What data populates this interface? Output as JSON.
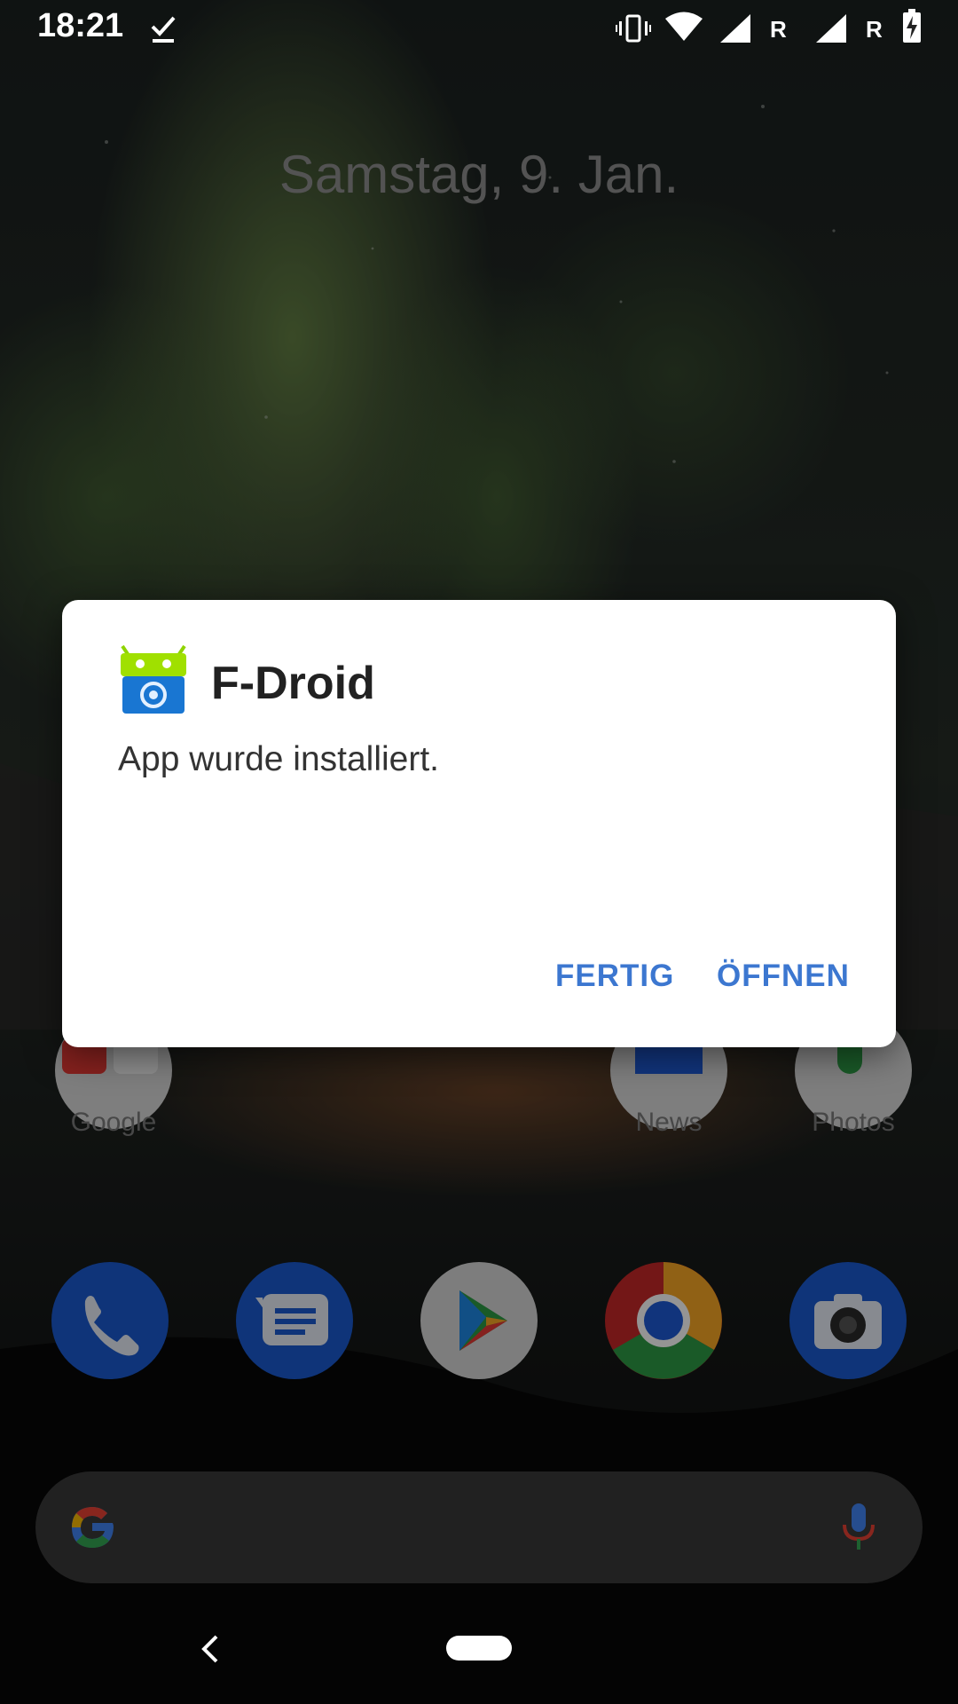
{
  "status_bar": {
    "time": "18:21",
    "icons": [
      "check-icon",
      "vibrate-icon",
      "wifi-icon",
      "signal-icon",
      "signal-icon",
      "battery-charging-icon"
    ],
    "roaming_label_1": "R",
    "roaming_label_2": "R"
  },
  "home": {
    "date": "Samstag, 9. Jan.",
    "row_apps": [
      {
        "label": "Google",
        "icon": "google-folder-icon"
      },
      {
        "label": "News",
        "icon": "news-icon"
      },
      {
        "label": "Photos",
        "icon": "photos-icon"
      }
    ],
    "dock": [
      {
        "icon": "phone-icon"
      },
      {
        "icon": "messages-icon"
      },
      {
        "icon": "play-store-icon"
      },
      {
        "icon": "chrome-icon"
      },
      {
        "icon": "camera-icon"
      }
    ],
    "search_bar": {
      "left_icon": "google-g-icon",
      "right_icon": "mic-icon"
    }
  },
  "dialog": {
    "app_name": "F-Droid",
    "message": "App wurde installiert.",
    "buttons": {
      "done": "FERTIG",
      "open": "ÖFFNEN"
    },
    "accent_color": "#3c77d0"
  },
  "nav": {
    "back_icon": "back-icon",
    "home_icon": "home-pill-icon"
  }
}
